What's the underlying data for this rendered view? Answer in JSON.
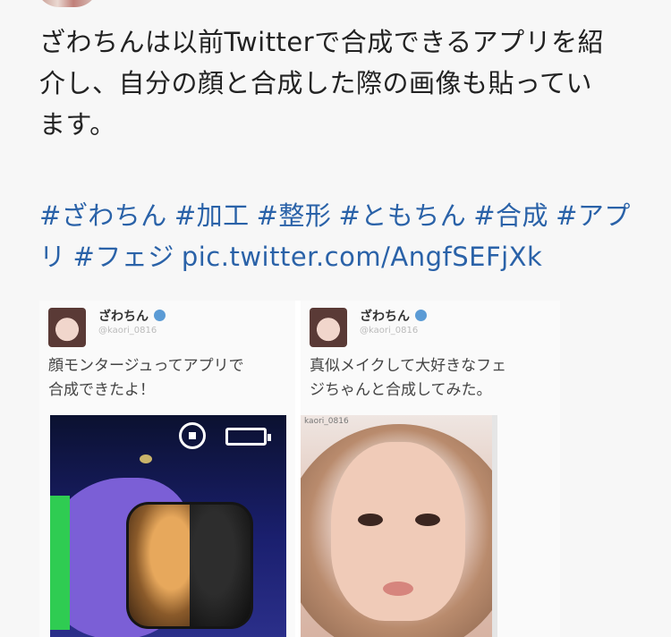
{
  "tweet": {
    "lines": [
      "ざわちんは以前Twitterで合成できるアプリを紹",
      "介し、自分の顔と合成した際の画像も貼ってい",
      "ます。"
    ],
    "hashtags_line1": [
      "#ざわちん",
      "#加工",
      "#整形",
      "#ともちん",
      "#合成",
      "#アプ"
    ],
    "hashtags_line2": [
      "リ",
      "#フェジ",
      "pic.twitter.com/AngfSEFjXk"
    ]
  },
  "embedded": {
    "left": {
      "name": "ざわちん",
      "handle": "@kaori_0816",
      "text_lines": [
        "顔モンタージュってアプリで",
        "合成できたよ！"
      ]
    },
    "right": {
      "name": "ざわちん",
      "handle": "@kaori_0816",
      "text_lines": [
        "真似メイクして大好きなフェ",
        "ジちゃんと合成してみた。"
      ],
      "photo_caption": "kaori_0816"
    }
  },
  "icons": [
    "rotate-lock-icon",
    "battery-icon",
    "verified-badge-icon"
  ],
  "colors": {
    "link": "#2a62a8",
    "text": "#222222",
    "verified": "#5b9bd5"
  }
}
